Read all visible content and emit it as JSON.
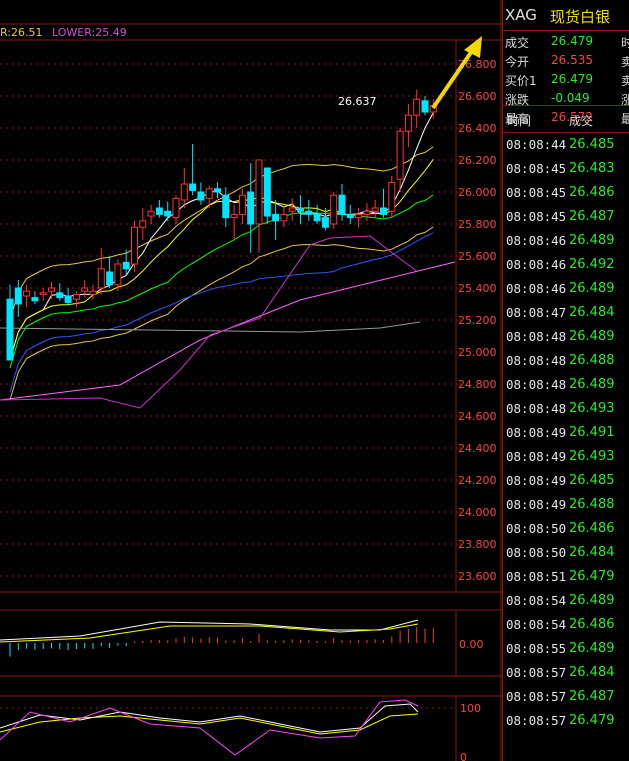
{
  "legend": {
    "upper": "R:26.51",
    "lower": "LOWER:25.49"
  },
  "colors": {
    "up": "#ff3333",
    "down": "#00e5ff",
    "ma5": "#ffffff",
    "ma10": "#ffff00",
    "ma20": "#00ff00",
    "ma60": "#3355ff",
    "grid": "#8a1515"
  },
  "price_axis": [
    "26.800",
    "26.600",
    "26.400",
    "26.200",
    "26.000",
    "25.800",
    "25.600",
    "25.400",
    "25.200",
    "25.000",
    "24.800",
    "24.600",
    "24.400",
    "24.200",
    "24.000",
    "23.800",
    "23.600"
  ],
  "high_annotation": "26.637",
  "macd_axis": "0.00",
  "kdj_axis": [
    "100",
    "0"
  ],
  "panel": {
    "code": "XAG",
    "name": "现货白银",
    "quote": [
      {
        "label": "成交",
        "value": "26.479",
        "color": "green",
        "cut": "时"
      },
      {
        "label": "今开",
        "value": "26.535",
        "color": "red",
        "cut": "卖"
      },
      {
        "label": "买价1",
        "value": "26.479",
        "color": "green",
        "cut": "卖"
      },
      {
        "label": "涨跌",
        "value": "-0.049",
        "color": "green",
        "cut": "涨"
      },
      {
        "label": "最高",
        "value": "26.572",
        "color": "red",
        "cut": "最"
      }
    ],
    "trade_header": {
      "time": "时间",
      "price": "成交"
    },
    "trades": [
      {
        "time": "08:08:44",
        "price": "26.485"
      },
      {
        "time": "08:08:45",
        "price": "26.483"
      },
      {
        "time": "08:08:45",
        "price": "26.486"
      },
      {
        "time": "08:08:45",
        "price": "26.487"
      },
      {
        "time": "08:08:46",
        "price": "26.489"
      },
      {
        "time": "08:08:46",
        "price": "26.492"
      },
      {
        "time": "08:08:46",
        "price": "26.489"
      },
      {
        "time": "08:08:47",
        "price": "26.484"
      },
      {
        "time": "08:08:48",
        "price": "26.489"
      },
      {
        "time": "08:08:48",
        "price": "26.488"
      },
      {
        "time": "08:08:48",
        "price": "26.489"
      },
      {
        "time": "08:08:48",
        "price": "26.493"
      },
      {
        "time": "08:08:49",
        "price": "26.491"
      },
      {
        "time": "08:08:49",
        "price": "26.493"
      },
      {
        "time": "08:08:49",
        "price": "26.485"
      },
      {
        "time": "08:08:49",
        "price": "26.488"
      },
      {
        "time": "08:08:50",
        "price": "26.486"
      },
      {
        "time": "08:08:50",
        "price": "26.484"
      },
      {
        "time": "08:08:51",
        "price": "26.479"
      },
      {
        "time": "08:08:54",
        "price": "26.489"
      },
      {
        "time": "08:08:54",
        "price": "26.486"
      },
      {
        "time": "08:08:55",
        "price": "26.489"
      },
      {
        "time": "08:08:57",
        "price": "26.484"
      },
      {
        "time": "08:08:57",
        "price": "26.487"
      },
      {
        "time": "08:08:57",
        "price": "26.479"
      }
    ]
  },
  "chart_data": {
    "type": "candlestick",
    "candles": [
      [
        25.33,
        25.42,
        25.0,
        24.95
      ],
      [
        25.4,
        25.45,
        25.22,
        25.3
      ],
      [
        25.35,
        25.42,
        25.28,
        25.38
      ],
      [
        25.34,
        25.38,
        25.3,
        25.32
      ],
      [
        25.36,
        25.4,
        25.32,
        25.37
      ],
      [
        25.38,
        25.44,
        25.33,
        25.4
      ],
      [
        25.37,
        25.43,
        25.32,
        25.34
      ],
      [
        25.35,
        25.4,
        25.29,
        25.31
      ],
      [
        25.33,
        25.38,
        25.28,
        25.36
      ],
      [
        25.38,
        25.45,
        25.34,
        25.4
      ],
      [
        25.36,
        25.42,
        25.33,
        25.38
      ],
      [
        25.4,
        25.65,
        25.36,
        25.52
      ],
      [
        25.5,
        25.6,
        25.4,
        25.42
      ],
      [
        25.42,
        25.58,
        25.38,
        25.55
      ],
      [
        25.56,
        25.64,
        25.48,
        25.52
      ],
      [
        25.55,
        25.82,
        25.5,
        25.78
      ],
      [
        25.78,
        25.9,
        25.7,
        25.82
      ],
      [
        25.85,
        25.92,
        25.8,
        25.88
      ],
      [
        25.9,
        25.95,
        25.84,
        25.86
      ],
      [
        25.88,
        25.94,
        25.82,
        25.85
      ],
      [
        25.84,
        25.98,
        25.8,
        25.96
      ],
      [
        25.95,
        26.15,
        25.9,
        26.05
      ],
      [
        26.05,
        26.3,
        25.98,
        26.01
      ],
      [
        26.0,
        26.06,
        25.92,
        25.95
      ],
      [
        25.96,
        26.04,
        25.9,
        26.02
      ],
      [
        26.02,
        26.06,
        25.96,
        26.0
      ],
      [
        25.98,
        26.03,
        25.78,
        25.84
      ],
      [
        25.84,
        25.92,
        25.7,
        25.86
      ],
      [
        25.86,
        26.02,
        25.8,
        25.98
      ],
      [
        26.0,
        26.18,
        25.62,
        25.8
      ],
      [
        25.8,
        26.2,
        25.62,
        26.2
      ],
      [
        26.15,
        26.1,
        25.8,
        25.85
      ],
      [
        25.86,
        25.95,
        25.7,
        25.82
      ],
      [
        25.82,
        25.9,
        25.78,
        25.86
      ],
      [
        25.88,
        25.96,
        25.82,
        25.9
      ],
      [
        25.9,
        25.98,
        25.8,
        25.88
      ],
      [
        25.88,
        25.95,
        25.82,
        25.86
      ],
      [
        25.86,
        25.92,
        25.8,
        25.82
      ],
      [
        25.84,
        25.9,
        25.76,
        25.78
      ],
      [
        25.8,
        26.0,
        25.77,
        25.98
      ],
      [
        25.98,
        26.05,
        25.82,
        25.86
      ],
      [
        25.86,
        25.92,
        25.8,
        25.84
      ],
      [
        25.84,
        25.9,
        25.78,
        25.86
      ],
      [
        25.86,
        25.93,
        25.82,
        25.88
      ],
      [
        25.88,
        25.95,
        25.84,
        25.9
      ],
      [
        25.9,
        26.02,
        25.84,
        25.86
      ],
      [
        25.88,
        26.1,
        25.84,
        26.06
      ],
      [
        26.08,
        26.4,
        26.0,
        26.38
      ],
      [
        26.38,
        26.55,
        26.28,
        26.48
      ],
      [
        26.48,
        26.64,
        26.4,
        26.58
      ],
      [
        26.57,
        26.6,
        26.48,
        26.5
      ],
      [
        26.5,
        26.58,
        26.46,
        26.54
      ]
    ],
    "y_range": [
      23.5,
      26.9
    ]
  }
}
